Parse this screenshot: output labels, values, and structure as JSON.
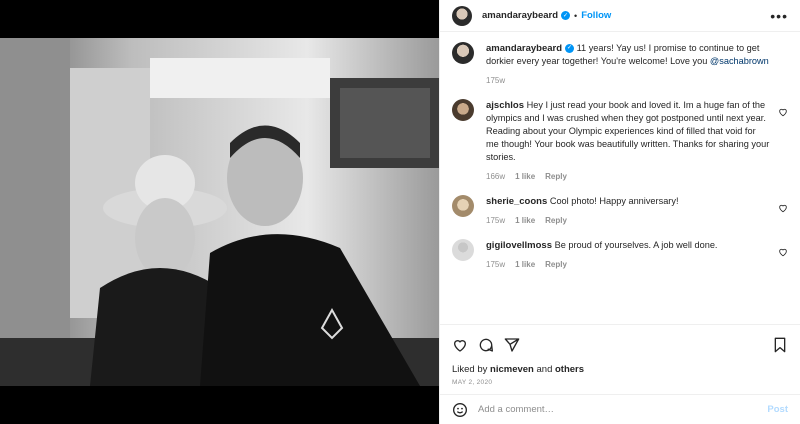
{
  "post": {
    "author": "amandaraybeard",
    "follow_label": "Follow",
    "dot": "•",
    "more": "•••"
  },
  "caption": {
    "username": "amandaraybeard",
    "text": "11 years! Yay us! I promise to continue to get dorkier every year together! You're welcome! Love you",
    "mention": "@sachabrown",
    "time": "175w"
  },
  "comments": [
    {
      "username": "ajschlos",
      "text": "Hey I just read your book and loved it. Im a huge fan of the olympics and I was crushed when they got postponed until next year. Reading about your Olympic experiences kind of filled that void for me though! Your book was beautifully written. Thanks for sharing your stories.",
      "time": "166w",
      "likes": "1 like",
      "reply": "Reply"
    },
    {
      "username": "sherie_coons",
      "text": "Cool photo! Happy anniversary!",
      "time": "175w",
      "likes": "1 like",
      "reply": "Reply"
    },
    {
      "username": "gigilovellmoss",
      "text": "Be proud of yourselves. A job well done.",
      "time": "175w",
      "likes": "1 like",
      "reply": "Reply"
    }
  ],
  "likes": {
    "prefix": "Liked by",
    "user": "nicmeven",
    "mid": "and",
    "others": "others"
  },
  "date": "MAY 2, 2020",
  "add_comment": {
    "placeholder": "Add a comment…",
    "post_label": "Post"
  },
  "icons": [
    "verified-icon",
    "more-icon",
    "heart-icon",
    "comment-icon",
    "share-icon",
    "save-icon",
    "emoji-icon"
  ],
  "colors": {
    "accent": "#0095f6",
    "muted": "#8e8e8e",
    "text": "#262626",
    "post_disabled": "#b3dbff"
  }
}
